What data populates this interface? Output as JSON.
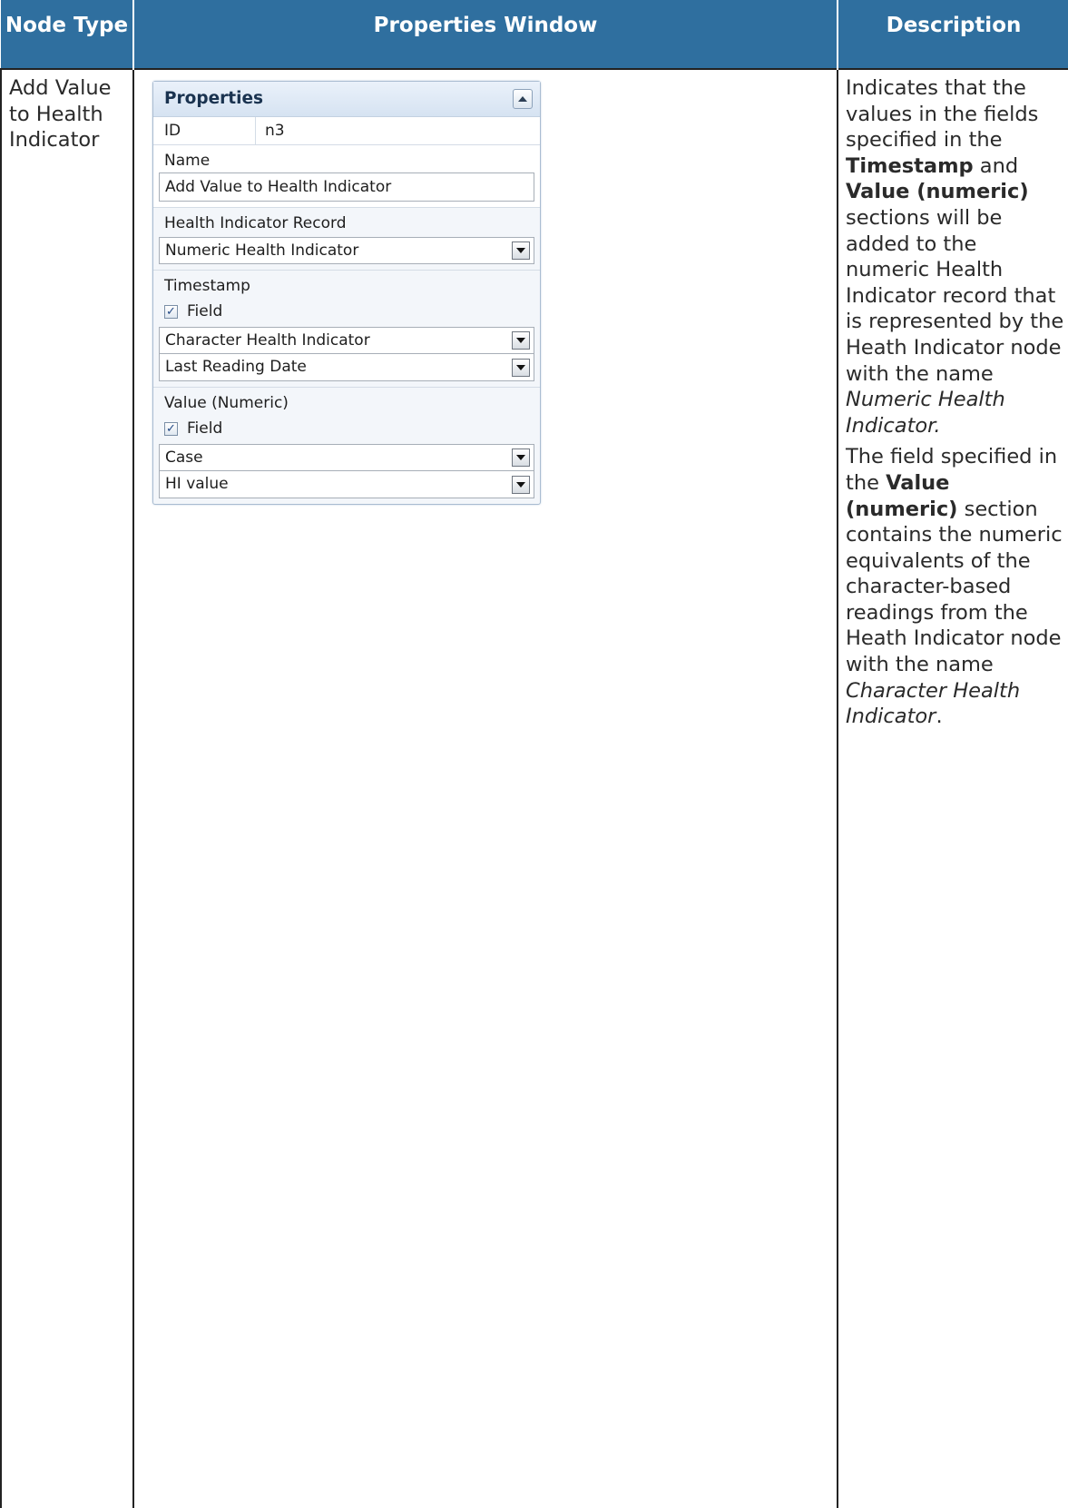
{
  "headers": {
    "node_type": "Node Type",
    "properties_window": "Properties Window",
    "description": "Description"
  },
  "row": {
    "node_type": "Add Value to Health Indicator",
    "properties": {
      "title": "Properties",
      "collapse_icon": "collapse-up-icon",
      "id_label": "ID",
      "id_value": "n3",
      "name_label": "Name",
      "name_value": "Add Value to Health Indicator",
      "hi_record_label": "Health Indicator Record",
      "hi_record_value": "Numeric Health Indicator",
      "timestamp_label": "Timestamp",
      "timestamp_field_label": "Field",
      "timestamp_field_checked": true,
      "timestamp_source": "Character Health Indicator",
      "timestamp_field": "Last Reading Date",
      "value_label": "Value (Numeric)",
      "value_field_label": "Field",
      "value_field_checked": true,
      "value_source": "Case",
      "value_field": "HI value"
    },
    "description": {
      "p1_a": "Indicates that the values in the fields specified in the ",
      "p1_b1": "Timestamp",
      "p1_c": " and ",
      "p1_b2": "Value (numeric)",
      "p1_d": " sections will be added to the numeric Health Indicator record that is represented by the Heath Indicator node with the name ",
      "p1_i": "Numeric Health Indicator",
      "p1_e": ".",
      "p2_a": "The field specified in the ",
      "p2_b": "Value (numeric)",
      "p2_c": " section contains the numeric equivalents of the character-based readings from the Heath Indicator node with the name ",
      "p2_i": "Character Health Indicator",
      "p2_e": "."
    }
  },
  "colors": {
    "header_bg": "#2f6f9f",
    "header_text": "#ffffff",
    "panel_border": "#a9bcd1"
  }
}
